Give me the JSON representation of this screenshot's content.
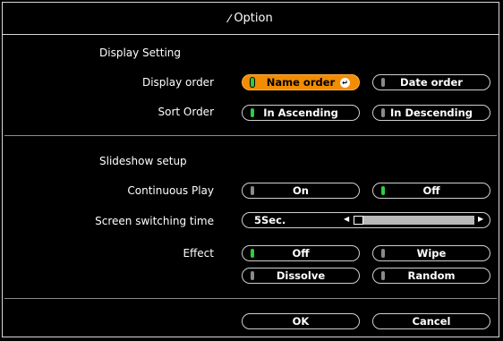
{
  "window": {
    "title": "Option",
    "icon": "wrench-screwdriver-icon"
  },
  "display_setting": {
    "heading": "Display Setting",
    "display_order": {
      "label": "Display order",
      "options": [
        "Name order",
        "Date order"
      ],
      "selected": "Name order"
    },
    "sort_order": {
      "label": "Sort Order",
      "options": [
        "In Ascending",
        "In Descending"
      ],
      "selected": "In Ascending"
    }
  },
  "slideshow_setup": {
    "heading": "Slideshow setup",
    "continuous_play": {
      "label": "Continuous Play",
      "options": [
        "On",
        "Off"
      ],
      "selected": "Off"
    },
    "screen_switching_time": {
      "label": "Screen switching time",
      "value": "5Sec.",
      "level": 0
    },
    "effect": {
      "label": "Effect",
      "options": [
        "Off",
        "Wipe",
        "Dissolve",
        "Random"
      ],
      "selected": "Off"
    }
  },
  "footer": {
    "ok_label": "OK",
    "cancel_label": "Cancel"
  },
  "colors": {
    "accent": "#f28c00",
    "indicator_on": "#2ecc40",
    "indicator_off": "#8a8a8a"
  }
}
